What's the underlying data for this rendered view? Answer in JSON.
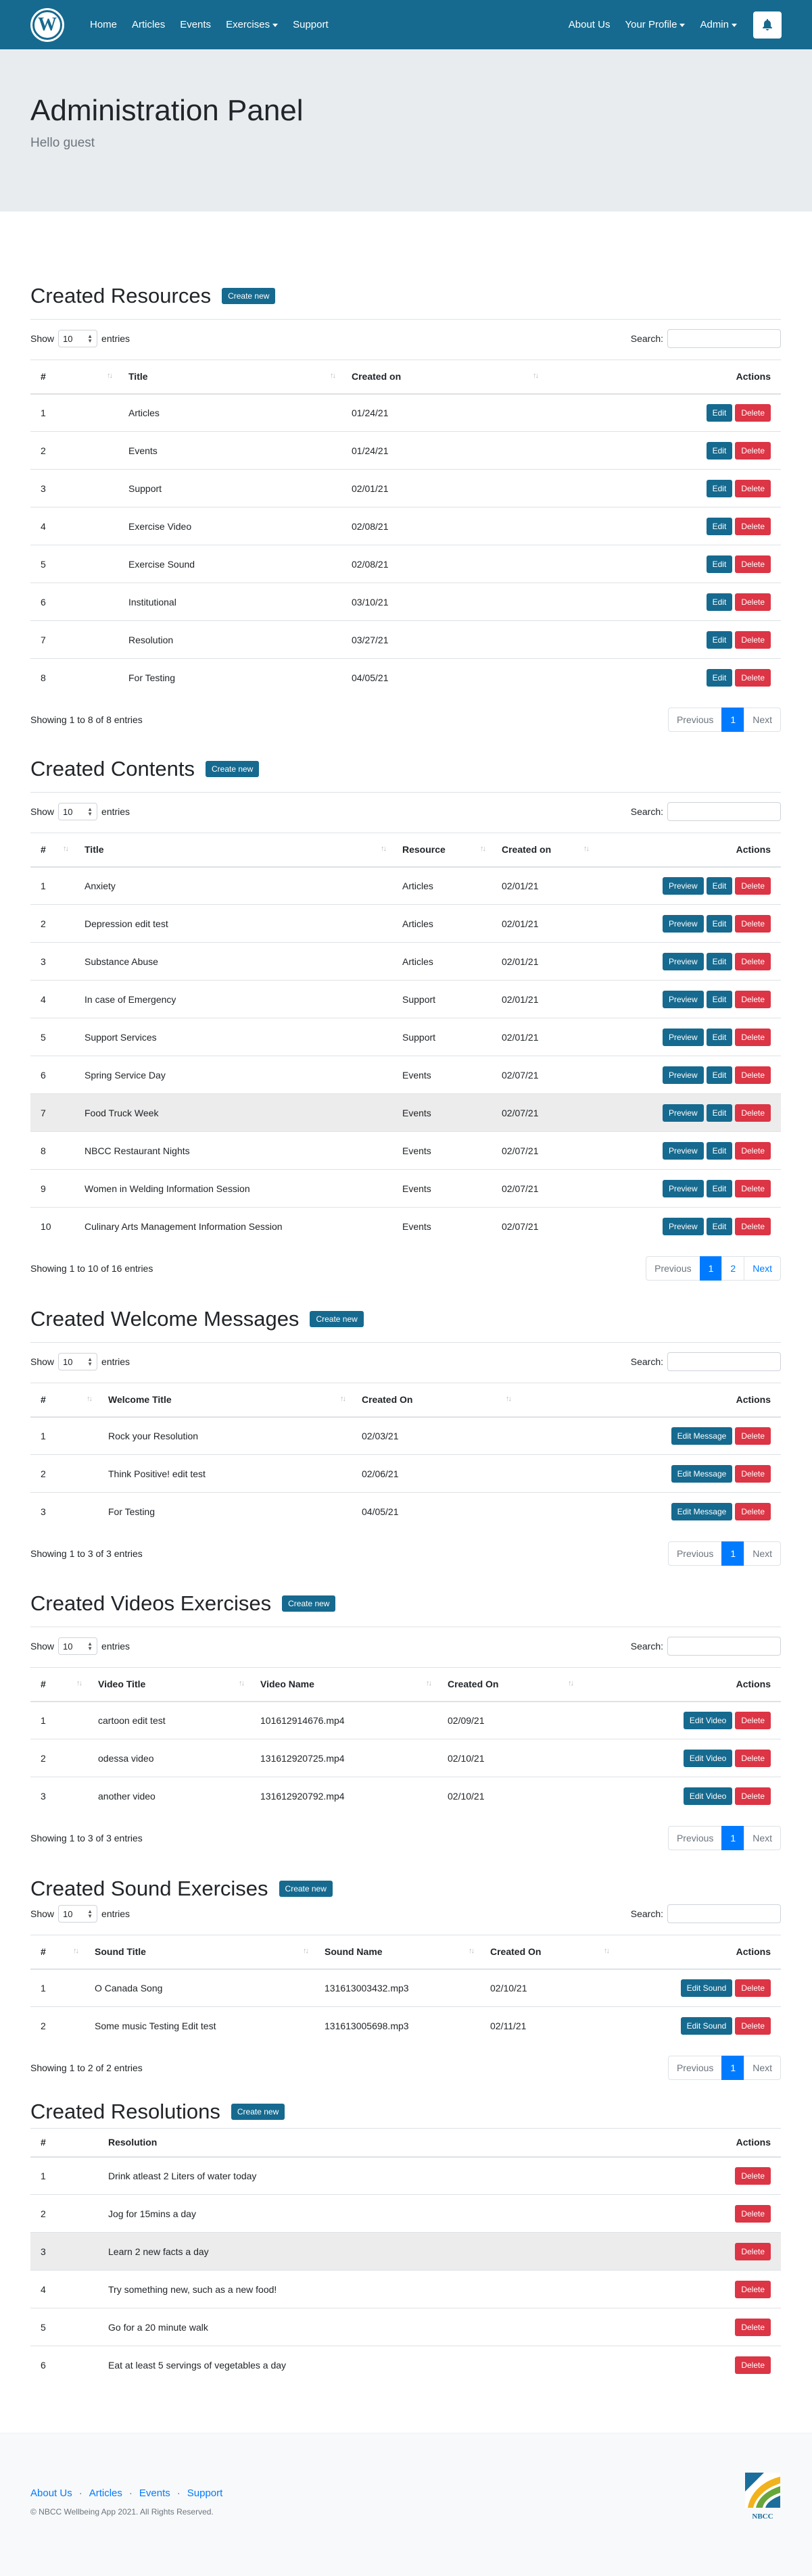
{
  "nav": {
    "left": [
      "Home",
      "Articles",
      "Events",
      "Exercises",
      "Support"
    ],
    "right": [
      "About Us",
      "Your Profile",
      "Admin"
    ]
  },
  "jumbo": {
    "title": "Administration Panel",
    "subtitle": "Hello guest"
  },
  "common": {
    "show": "Show",
    "entries": "entries",
    "entries_value": "10",
    "search": "Search:",
    "create_new": "Create new",
    "previous": "Previous",
    "next": "Next",
    "edit": "Edit",
    "delete": "Delete",
    "preview": "Preview",
    "edit_message": "Edit Message",
    "edit_video": "Edit Video",
    "edit_sound": "Edit Sound"
  },
  "resources": {
    "title": "Created Resources",
    "headers": [
      "#",
      "Title",
      "Created on",
      "Actions"
    ],
    "rows": [
      [
        "1",
        "Articles",
        "01/24/21"
      ],
      [
        "2",
        "Events",
        "01/24/21"
      ],
      [
        "3",
        "Support",
        "02/01/21"
      ],
      [
        "4",
        "Exercise Video",
        "02/08/21"
      ],
      [
        "5",
        "Exercise Sound",
        "02/08/21"
      ],
      [
        "6",
        "Institutional",
        "03/10/21"
      ],
      [
        "7",
        "Resolution",
        "03/27/21"
      ],
      [
        "8",
        "For Testing",
        "04/05/21"
      ]
    ],
    "info": "Showing 1 to 8 of 8 entries",
    "pages": [
      "1"
    ]
  },
  "contents": {
    "title": "Created Contents",
    "headers": [
      "#",
      "Title",
      "Resource",
      "Created on",
      "Actions"
    ],
    "rows": [
      [
        "1",
        "Anxiety",
        "Articles",
        "02/01/21"
      ],
      [
        "2",
        "Depression edit test",
        "Articles",
        "02/01/21"
      ],
      [
        "3",
        "Substance Abuse",
        "Articles",
        "02/01/21"
      ],
      [
        "4",
        "In case of Emergency",
        "Support",
        "02/01/21"
      ],
      [
        "5",
        "Support Services",
        "Support",
        "02/01/21"
      ],
      [
        "6",
        "Spring Service Day",
        "Events",
        "02/07/21"
      ],
      [
        "7",
        "Food Truck Week",
        "Events",
        "02/07/21"
      ],
      [
        "8",
        "NBCC Restaurant Nights",
        "Events",
        "02/07/21"
      ],
      [
        "9",
        "Women in Welding Information Session",
        "Events",
        "02/07/21"
      ],
      [
        "10",
        "Culinary Arts Management Information Session",
        "Events",
        "02/07/21"
      ]
    ],
    "info": "Showing 1 to 10 of 16 entries",
    "pages": [
      "1",
      "2"
    ]
  },
  "welcome": {
    "title": "Created Welcome Messages",
    "headers": [
      "#",
      "Welcome Title",
      "Created On",
      "Actions"
    ],
    "rows": [
      [
        "1",
        "Rock your Resolution",
        "02/03/21"
      ],
      [
        "2",
        "Think Positive! edit test",
        "02/06/21"
      ],
      [
        "3",
        "For Testing",
        "04/05/21"
      ]
    ],
    "info": "Showing 1 to 3 of 3 entries",
    "pages": [
      "1"
    ]
  },
  "videos": {
    "title": "Created Videos Exercises",
    "headers": [
      "#",
      "Video Title",
      "Video Name",
      "Created On",
      "Actions"
    ],
    "rows": [
      [
        "1",
        "cartoon edit test",
        "101612914676.mp4",
        "02/09/21"
      ],
      [
        "2",
        "odessa video",
        "131612920725.mp4",
        "02/10/21"
      ],
      [
        "3",
        "another video",
        "131612920792.mp4",
        "02/10/21"
      ]
    ],
    "info": "Showing 1 to 3 of 3 entries",
    "pages": [
      "1"
    ]
  },
  "sounds": {
    "title": "Created Sound Exercises",
    "headers": [
      "#",
      "Sound Title",
      "Sound Name",
      "Created On",
      "Actions"
    ],
    "rows": [
      [
        "1",
        "O Canada Song",
        "131613003432.mp3",
        "02/10/21"
      ],
      [
        "2",
        "Some music Testing Edit test",
        "131613005698.mp3",
        "02/11/21"
      ]
    ],
    "info": "Showing 1 to 2 of 2 entries",
    "pages": [
      "1"
    ]
  },
  "resolutions": {
    "title": "Created Resolutions",
    "headers": [
      "#",
      "Resolution",
      "Actions"
    ],
    "rows": [
      [
        "1",
        "Drink atleast 2 Liters of water today"
      ],
      [
        "2",
        "Jog for 15mins a day"
      ],
      [
        "3",
        "Learn 2 new facts a day"
      ],
      [
        "4",
        "Try something new, such as a new food!"
      ],
      [
        "5",
        "Go for a 20 minute walk"
      ],
      [
        "6",
        "Eat at least 5 servings of vegetables a day"
      ]
    ]
  },
  "footer": {
    "links": [
      "About Us",
      "Articles",
      "Events",
      "Support"
    ],
    "copyright": "© NBCC Wellbeing App 2021. All Rights Reserved.",
    "logo_text": "NBCC"
  }
}
